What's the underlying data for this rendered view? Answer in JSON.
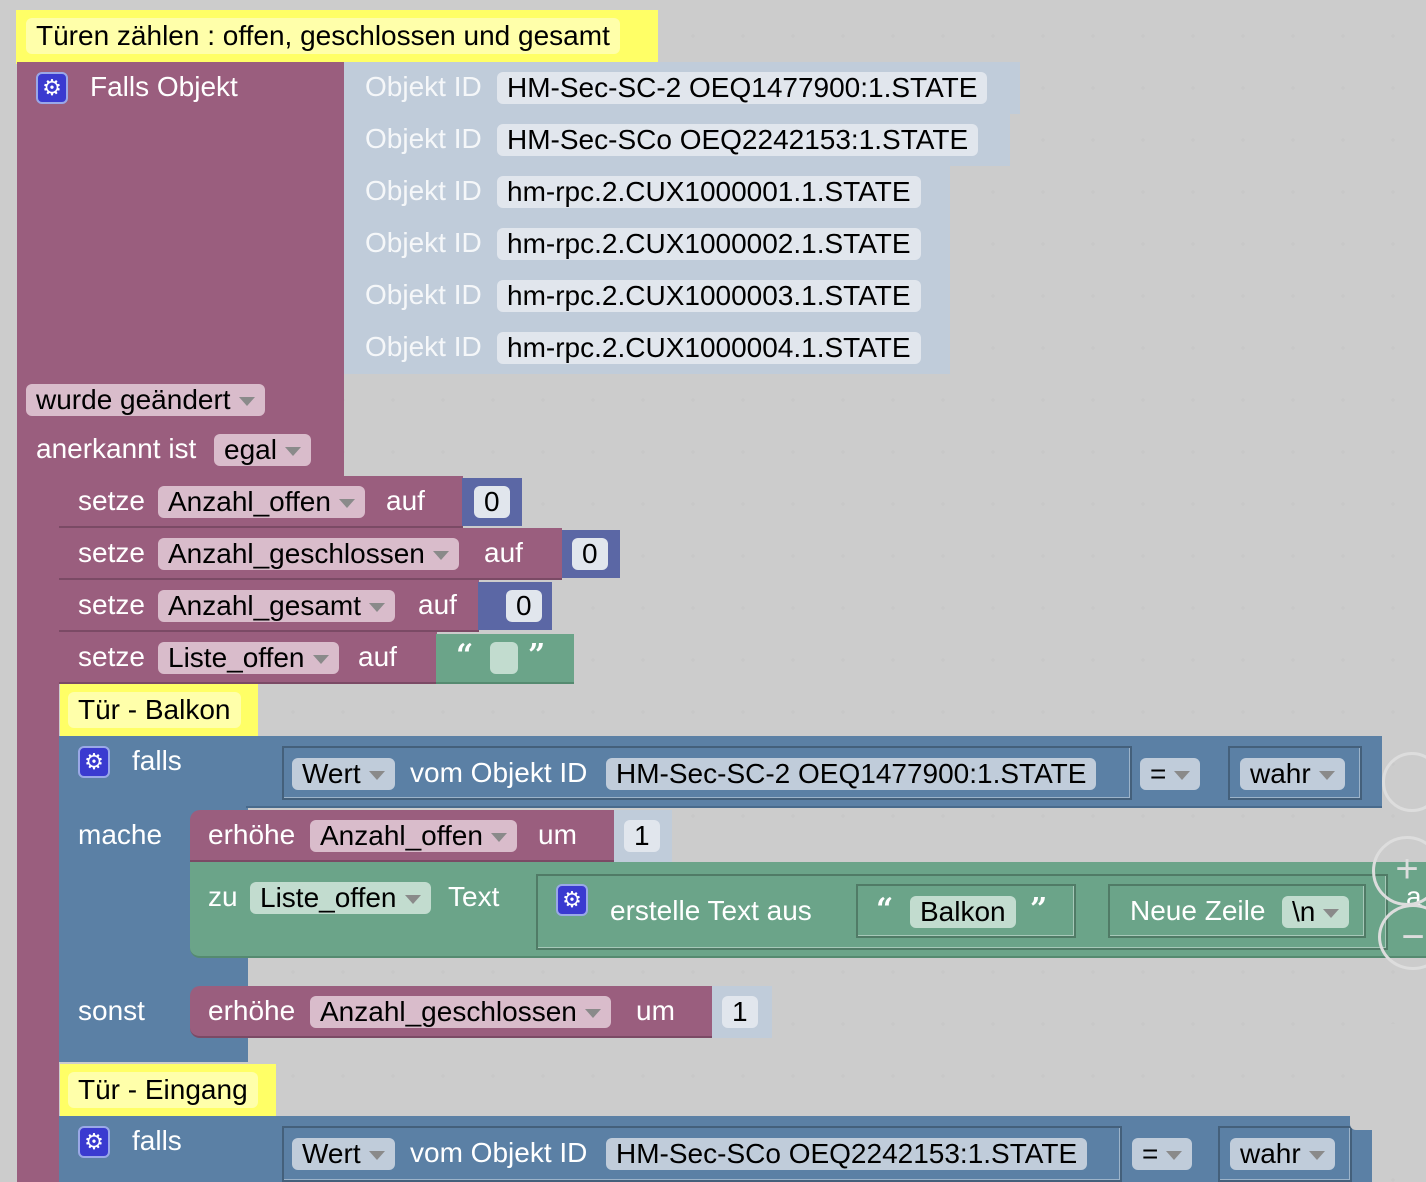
{
  "comments": {
    "main": "Türen zählen : offen, geschlossen und gesamt",
    "balkon": "Tür - Balkon",
    "eingang": "Tür - Eingang"
  },
  "trigger": {
    "label": "Falls Objekt",
    "objekt_label": "Objekt ID",
    "objects": [
      "HM-Sec-SC-2 OEQ1477900:1.STATE",
      "HM-Sec-SCo OEQ2242153:1.STATE",
      "hm-rpc.2.CUX1000001.1.STATE",
      "hm-rpc.2.CUX1000002.1.STATE",
      "hm-rpc.2.CUX1000003.1.STATE",
      "hm-rpc.2.CUX1000004.1.STATE"
    ],
    "event": "wurde geändert",
    "ack_label": "anerkannt ist",
    "ack_value": "egal"
  },
  "setze": [
    {
      "kw": "setze",
      "var": "Anzahl_offen",
      "auf": "auf",
      "value": "0"
    },
    {
      "kw": "setze",
      "var": "Anzahl_geschlossen",
      "auf": "auf",
      "value": "0"
    },
    {
      "kw": "setze",
      "var": "Anzahl_gesamt",
      "auf": "auf",
      "value": "0"
    },
    {
      "kw": "setze",
      "var": "Liste_offen",
      "auf": "auf",
      "value": ""
    }
  ],
  "if1": {
    "falls": "falls",
    "wert": "Wert",
    "vom": "vom Objekt ID",
    "object": "HM-Sec-SC-2 OEQ1477900:1.STATE",
    "op": "=",
    "cmp": "wahr",
    "mache": "mache",
    "inc1": {
      "kw": "erhöhe",
      "var": "Anzahl_offen",
      "um": "um",
      "value": "1"
    },
    "append": {
      "zu": "zu",
      "var": "Liste_offen",
      "text": "Text",
      "create": "erstelle Text aus",
      "str": "Balkon",
      "nl_label": "Neue Zeile",
      "nl_value": "\\n",
      "more": "a"
    },
    "sonst": "sonst",
    "inc2": {
      "kw": "erhöhe",
      "var": "Anzahl_geschlossen",
      "um": "um",
      "value": "1"
    }
  },
  "if2": {
    "falls": "falls",
    "wert": "Wert",
    "vom": "vom Objekt ID",
    "object": "HM-Sec-SCo OEQ2242153:1.STATE",
    "op": "=",
    "cmp": "wahr"
  },
  "colors": {
    "trigger": "#9a5e7e",
    "object": "#c0ccda",
    "logic": "#5b80a5",
    "math": "#5b67a5",
    "text": "#6ba489",
    "comment": "#ffff66"
  }
}
